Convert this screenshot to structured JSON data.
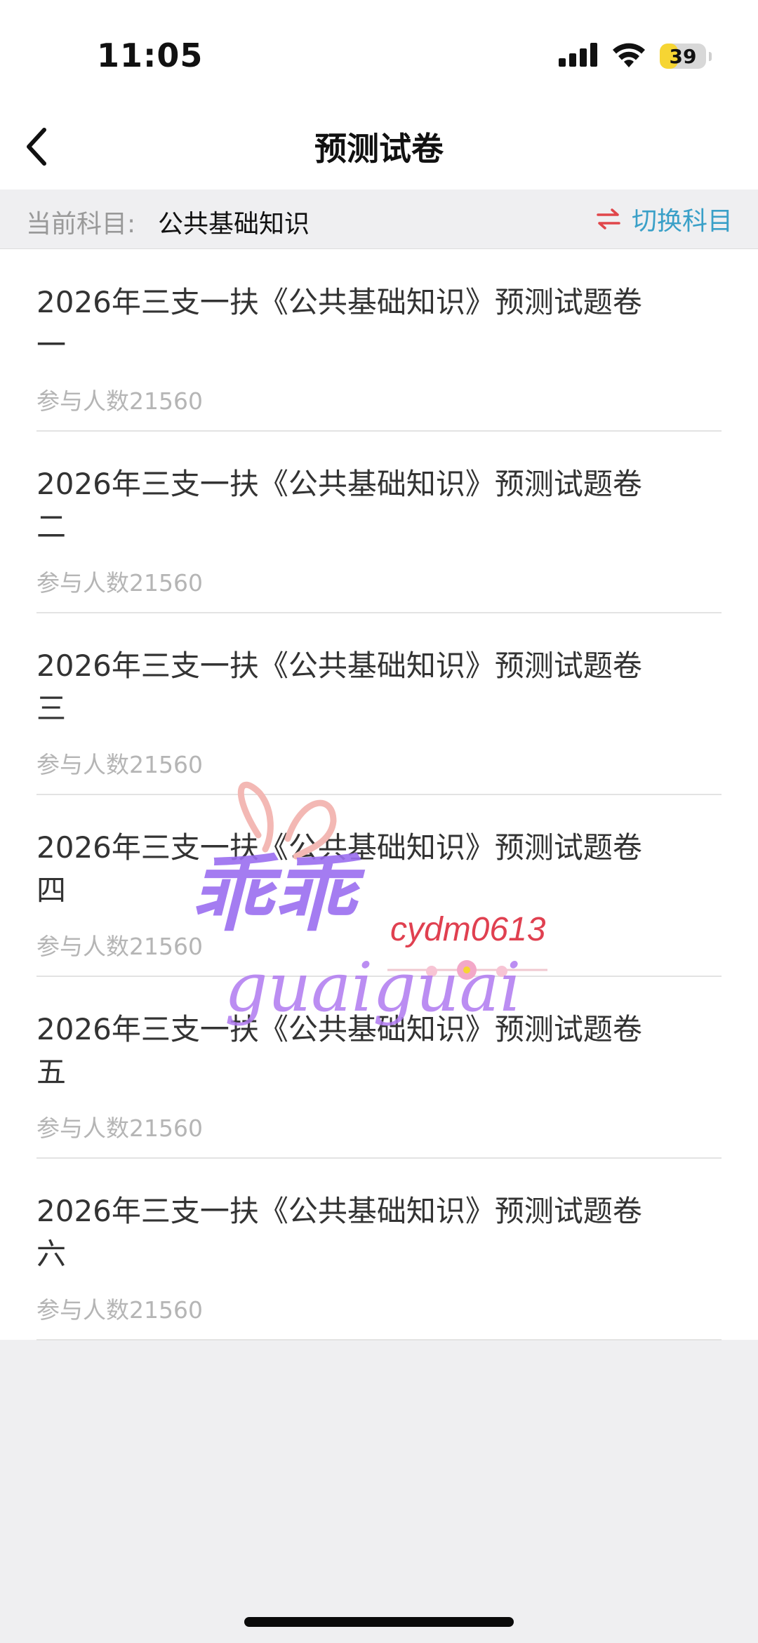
{
  "status_bar": {
    "time": "11:05",
    "battery_level": "39",
    "battery_fraction": 0.39,
    "icons": [
      "cellular-signal-icon",
      "wifi-icon",
      "battery-icon"
    ]
  },
  "nav": {
    "title": "预测试卷",
    "back_icon": "chevron-left-icon"
  },
  "subject": {
    "label": "当前科目:",
    "value": "公共基础知识",
    "switch_label": "切换科目",
    "switch_icon": "swap-arrows-icon"
  },
  "papers": [
    {
      "title": "2026年三支一扶《公共基础知识》预测试题卷一",
      "participants": "参与人数21560"
    },
    {
      "title": "2026年三支一扶《公共基础知识》预测试题卷二",
      "participants": "参与人数21560"
    },
    {
      "title": "2026年三支一扶《公共基础知识》预测试题卷三",
      "participants": "参与人数21560"
    },
    {
      "title": "2026年三支一扶《公共基础知识》预测试题卷四",
      "participants": "参与人数21560"
    },
    {
      "title": "2026年三支一扶《公共基础知识》预测试题卷五",
      "participants": "参与人数21560"
    },
    {
      "title": "2026年三支一扶《公共基础知识》预测试题卷六",
      "participants": "参与人数21560"
    }
  ],
  "watermark": {
    "handle": "cydm0613",
    "script_text": "guaiguai",
    "chinese_text": "乖乖"
  },
  "colors": {
    "accent": "#3aa0c8",
    "swap_icon": "#e0464a",
    "muted": "#b5b5b5"
  }
}
